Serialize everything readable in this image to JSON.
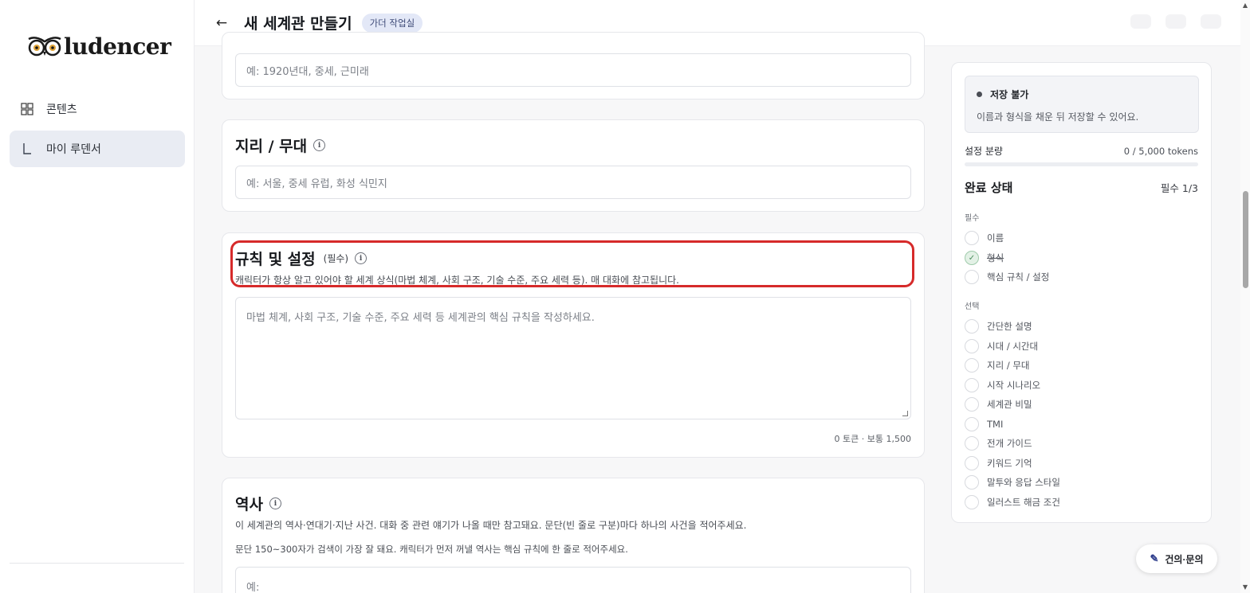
{
  "sidebar": {
    "logo_text": "ludencer",
    "items": [
      {
        "label": "콘텐츠",
        "icon": "grid-icon"
      },
      {
        "label": "마이 루덴서",
        "icon": "corner-icon"
      }
    ]
  },
  "header": {
    "back_icon": "arrow-left-icon",
    "title": "새 세계관 만들기",
    "badge": "가더 작업실"
  },
  "era_card": {
    "placeholder": "예: 1920년대, 중세, 근미래"
  },
  "geo_card": {
    "title": "지리 / 무대",
    "placeholder": "예: 서울, 중세 유럽, 화성 식민지"
  },
  "rules_card": {
    "title": "규칙 및 설정",
    "required": "(필수)",
    "description": "캐릭터가 항상 알고 있어야 할 세계 상식(마법 체계, 사회 구조, 기술 수준, 주요 세력 등). 매 대화에 참고됩니다.",
    "placeholder": "마법 체계, 사회 구조, 기술 수준, 주요 세력 등 세계관의 핵심 규칙을 작성하세요.",
    "token_info": "0 토큰 · 보통 1,500"
  },
  "history_card": {
    "title": "역사",
    "description": "이 세계관의 역사·연대기·지난 사건. 대화 중 관련 얘기가 나올 때만 참고돼요. 문단(빈 줄로 구분)마다 하나의 사건을 적어주세요.",
    "hint": "문단 150~300자가 검색이 가장 잘 돼요. 캐릭터가 먼저 꺼낼 역사는 핵심 규칙에 한 줄로 적어주세요.",
    "placeholder": "예:"
  },
  "panel": {
    "save_title": "저장 불가",
    "save_desc": "이름과 형식을 채운 뒤 저장할 수 있어요.",
    "amount_label": "설정 분량",
    "amount_value": "0 / 5,000 tokens",
    "amount_fraction": 0,
    "status_title": "완료 상태",
    "status_count": "필수 1/3",
    "required_label": "필수",
    "required_items": [
      {
        "label": "이름",
        "done": false
      },
      {
        "label": "형식",
        "done": true
      },
      {
        "label": "핵심 규칙 / 설정",
        "done": false
      }
    ],
    "optional_label": "선택",
    "optional_items": [
      {
        "label": "간단한 설명"
      },
      {
        "label": "시대 / 시간대"
      },
      {
        "label": "지리 / 무대"
      },
      {
        "label": "시작 시나리오"
      },
      {
        "label": "세계관 비밀"
      },
      {
        "label": "TMI"
      },
      {
        "label": "전개 가이드"
      },
      {
        "label": "키워드 기억"
      },
      {
        "label": "말투와 응답 스타일"
      },
      {
        "label": "일러스트 해금 조건"
      }
    ]
  },
  "fab": {
    "label": "건의·문의",
    "icon": "pencil-icon"
  },
  "colors": {
    "accent": "#3f4b78",
    "highlight": "#d62a2a",
    "done_green": "#4b8c5d"
  }
}
